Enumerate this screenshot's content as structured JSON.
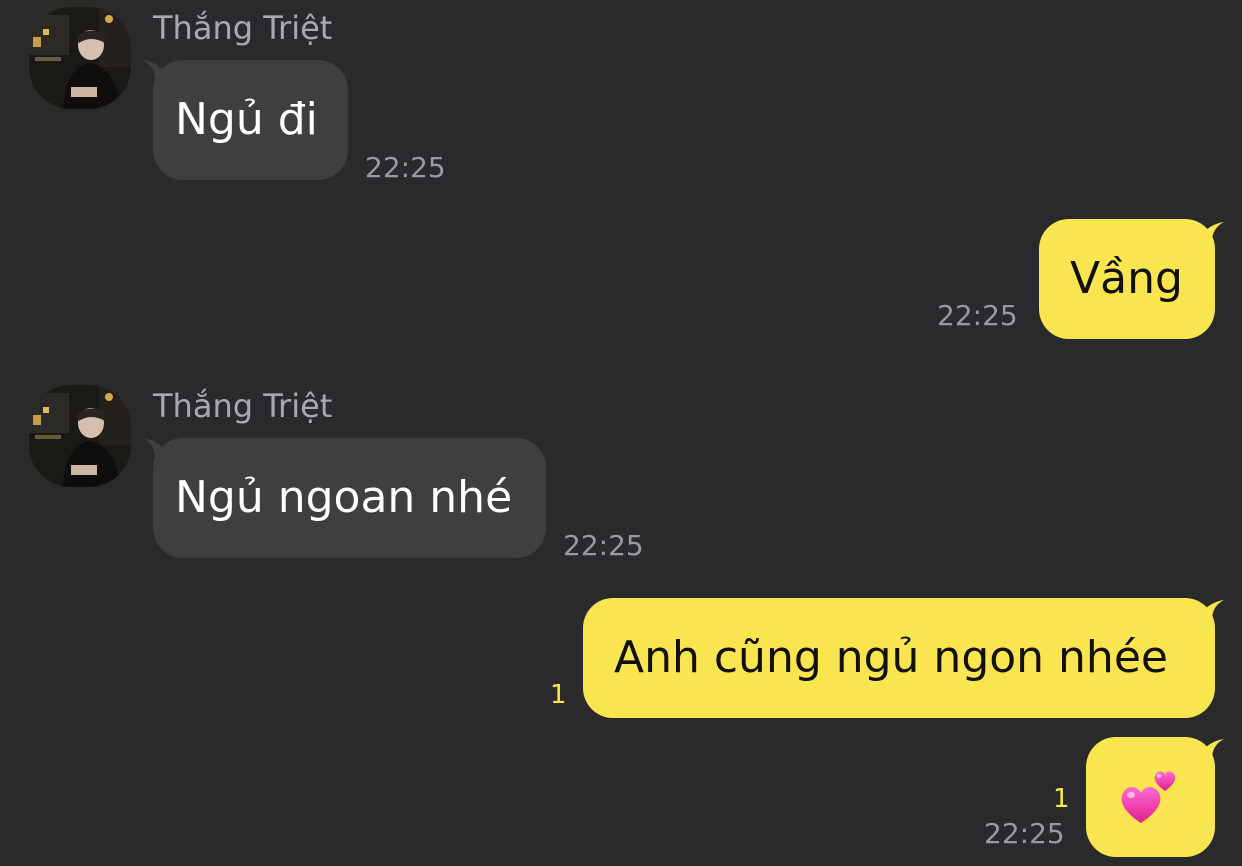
{
  "colors": {
    "background": "#2a2a2c",
    "incoming_bubble": "#3f3f42",
    "outgoing_bubble": "#f9e54f",
    "meta_text": "#9a9a9e",
    "unread_count": "#f9e54f"
  },
  "messages": [
    {
      "direction": "incoming",
      "sender": "Thắng Triệt",
      "text": "Ngủ đi",
      "time": "22:25"
    },
    {
      "direction": "outgoing",
      "text": "Vầng",
      "time": "22:25"
    },
    {
      "direction": "incoming",
      "sender": "Thắng Triệt",
      "text": "Ngủ ngoan nhé",
      "time": "22:25"
    },
    {
      "direction": "outgoing",
      "text": "Anh cũng ngủ ngon nhée",
      "unread": "1"
    },
    {
      "direction": "outgoing",
      "emoji": "two-hearts-emoji",
      "unread": "1",
      "time": "22:25"
    }
  ]
}
